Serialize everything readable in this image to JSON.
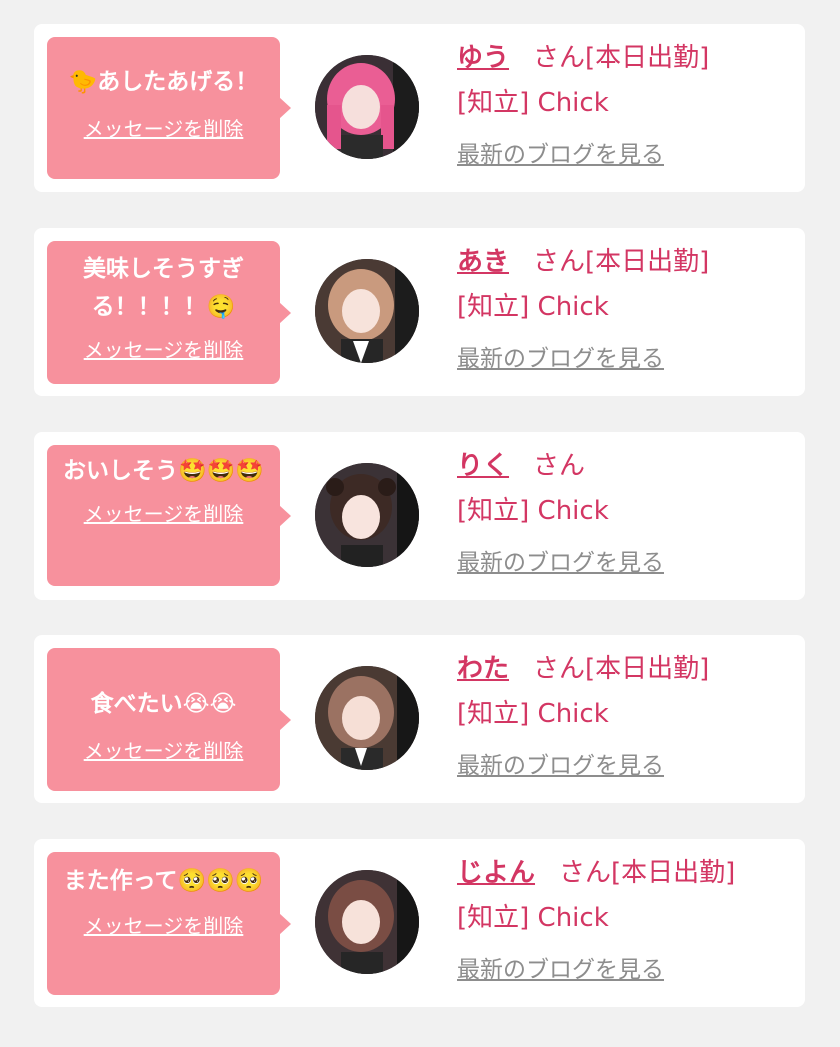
{
  "colors": {
    "accent": "#d33663",
    "bubble": "#f7919d",
    "link_gray": "#8d8d8d",
    "background": "#f1f1f1",
    "card": "#ffffff"
  },
  "items": [
    {
      "message": "🐤あしたあげる！",
      "delete_label": "メッセージを削除",
      "name": "ゆう",
      "honorific": "さん[本日出勤]",
      "shop": "[知立] Chick",
      "blog_label": "最新のブログを見る",
      "avatar": "pink-hair-avatar"
    },
    {
      "message": "美味しそうすぎる！！！！🤤",
      "delete_label": "メッセージを削除",
      "name": "あき",
      "honorific": "さん[本日出勤]",
      "shop": "[知立] Chick",
      "blog_label": "最新のブログを見る",
      "avatar": "brown-hair-avatar"
    },
    {
      "message": "おいしそう🤩🤩🤩",
      "delete_label": "メッセージを削除",
      "name": "りく",
      "honorific": "さん",
      "shop": "[知立] Chick",
      "blog_label": "最新のブログを見る",
      "avatar": "twin-tail-avatar"
    },
    {
      "message": "食べたい😭😭",
      "delete_label": "メッセージを削除",
      "name": "わた",
      "honorific": "さん[本日出勤]",
      "shop": "[知立] Chick",
      "blog_label": "最新のブログを見る",
      "avatar": "light-brown-hair-avatar"
    },
    {
      "message": "また作って🥺🥺🥺",
      "delete_label": "メッセージを削除",
      "name": "じよん",
      "honorific": "さん[本日出勤]",
      "shop": "[知立] Chick",
      "blog_label": "最新のブログを見る",
      "avatar": "auburn-hair-avatar"
    }
  ]
}
